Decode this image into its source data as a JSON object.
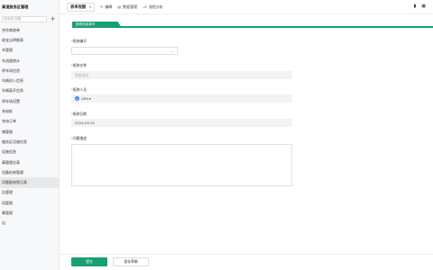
{
  "sidebar": {
    "title": "高速服务区管理",
    "search_placeholder": "搜索表/视图",
    "add_icon": "plus-icon",
    "items": [
      {
        "label": "合作商收单"
      },
      {
        "label": "收支出明细表"
      },
      {
        "label": "车管理"
      },
      {
        "label": "车流量统计"
      },
      {
        "label": "停车场信息"
      },
      {
        "label": "车辆进入信息"
      },
      {
        "label": "车辆离开信息"
      },
      {
        "label": "停车场设置"
      },
      {
        "label": "充电桩"
      },
      {
        "label": "充电订单"
      },
      {
        "label": "铺管理"
      },
      {
        "label": "服务区设施信息"
      },
      {
        "label": "设施信息"
      },
      {
        "label": "事管理总表"
      },
      {
        "label": "设备检修管理"
      },
      {
        "label": "问题报修登记表",
        "active": true
      },
      {
        "label": "告管理"
      },
      {
        "label": "局管理"
      },
      {
        "label": "事管理"
      },
      {
        "label": "出"
      }
    ]
  },
  "topbar": {
    "view_select": "表单视图",
    "actions": [
      {
        "label": "编辑",
        "icon": "pencil-icon"
      },
      {
        "label": "数据管理",
        "icon": "database-icon"
      },
      {
        "label": "流程分析",
        "icon": "flow-icon"
      }
    ],
    "right_icons": [
      "bookmark-icon",
      "share-icon"
    ]
  },
  "form": {
    "section_title": "报修信息填写",
    "fields": {
      "report_no": {
        "label": "报修编号",
        "required": true
      },
      "report_name": {
        "label": "报修名称",
        "required": true,
        "placeholder": "系统自动"
      },
      "reporter": {
        "label": "报修人员",
        "required": true,
        "value": "Office",
        "avatar_initial": "O"
      },
      "report_date": {
        "label": "报修日期",
        "required": true,
        "value": "2024-05-22"
      },
      "description": {
        "label": "问题描述",
        "required": true
      }
    },
    "submit_label": "提交",
    "save_draft_label": "保存草稿"
  },
  "colors": {
    "accent": "#1a9e74",
    "required": "#e5484d",
    "avatar": "#3b82f6"
  }
}
